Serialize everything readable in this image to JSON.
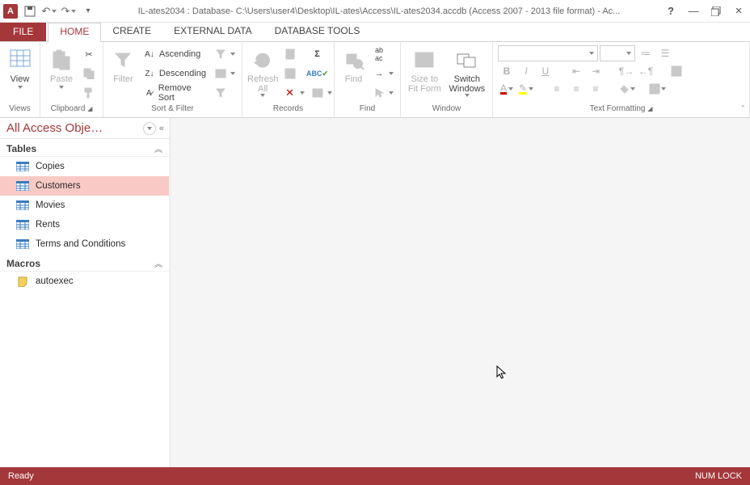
{
  "title": "IL-ates2034 : Database- C:\\Users\\user4\\Desktop\\IL-ates\\Access\\IL-ates2034.accdb (Access 2007 - 2013 file format) - Ac...",
  "app_letter": "A",
  "tabs": {
    "file": "FILE",
    "home": "HOME",
    "create": "CREATE",
    "external": "EXTERNAL DATA",
    "dbtools": "DATABASE TOOLS"
  },
  "ribbon": {
    "views": {
      "btn": "View",
      "label": "Views"
    },
    "clipboard": {
      "btn": "Paste",
      "label": "Clipboard"
    },
    "sortfilter": {
      "btn": "Filter",
      "asc": "Ascending",
      "desc": "Descending",
      "remove": "Remove Sort",
      "label": "Sort & Filter"
    },
    "records": {
      "btn": "Refresh\nAll",
      "label": "Records"
    },
    "find": {
      "btn": "Find",
      "label": "Find"
    },
    "window": {
      "size": "Size to\nFit Form",
      "switch": "Switch\nWindows",
      "label": "Window"
    },
    "textfmt": {
      "label": "Text Formatting",
      "bold": "B",
      "italic": "I",
      "underline": "U",
      "fontcolor": "A"
    }
  },
  "nav": {
    "title": "All Access Obje…",
    "sections": {
      "tables": "Tables",
      "macros": "Macros"
    },
    "tables": [
      "Copies",
      "Customers",
      "Movies",
      "Rents",
      "Terms and Conditions"
    ],
    "selected_table": "Customers",
    "macros": [
      "autoexec"
    ]
  },
  "status": {
    "ready": "Ready",
    "numlock": "NUM LOCK"
  }
}
